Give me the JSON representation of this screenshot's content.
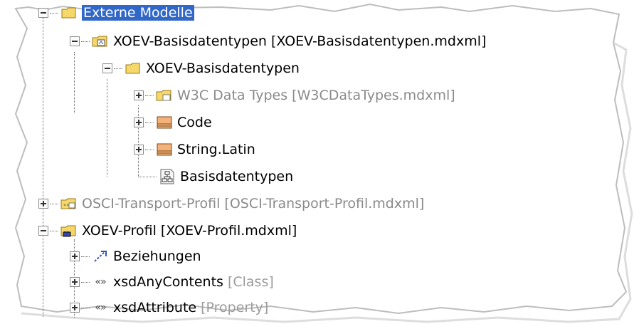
{
  "tree": {
    "externe_modelle": {
      "label": "Externe Modelle"
    },
    "xoev_basis_module": {
      "label": "XOEV-Basisdatentypen [XOEV-Basisdatentypen.mdxml]"
    },
    "xoev_basis_package": {
      "label": "XOEV-Basisdatentypen"
    },
    "w3c_module": {
      "label": "W3C Data Types [W3CDataTypes.mdxml]"
    },
    "code": {
      "label": "Code"
    },
    "string_latin": {
      "label": "String.Latin"
    },
    "basisdatentypen_diagram": {
      "label": "Basisdatentypen"
    },
    "osci_module": {
      "label": "OSCI-Transport-Profil [OSCI-Transport-Profil.mdxml]"
    },
    "xoev_profil": {
      "label": "XOEV-Profil [XOEV-Profil.mdxml]"
    },
    "beziehungen": {
      "label": "Beziehungen"
    },
    "xsd_any_contents": {
      "label": "xsdAnyContents",
      "type": "[Class]"
    },
    "xsd_attribute": {
      "label": "xsdAttribute",
      "type": "[Property]"
    }
  },
  "colors": {
    "selection": "#3167c6",
    "grayed_text": "#8a8a8a",
    "folder_yellow": "#f6d86a",
    "class_orange": "#e8904a"
  },
  "icons": {
    "folder": "folder-icon",
    "module": "module-package-icon",
    "profile": "profile-package-icon",
    "class": "class-icon",
    "diagram": "diagram-icon",
    "relations": "relations-icon",
    "stereotype": "stereotype-icon"
  }
}
